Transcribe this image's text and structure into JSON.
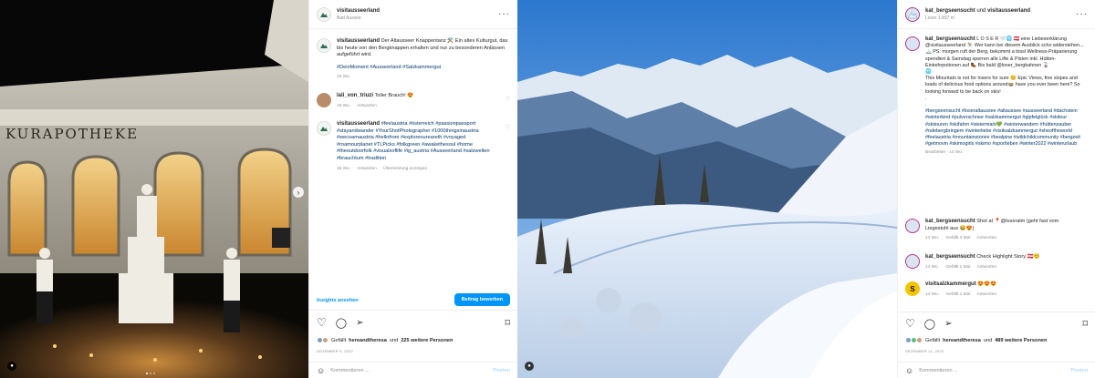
{
  "post1": {
    "header": {
      "username": "visitausseerland",
      "location": "Bad Aussee"
    },
    "caption": {
      "username": "visitausseerland",
      "text": "Der Altausseer Knappentanz ⚒️ Ein altes Kulturgut, das bis heute von den Bergknappen erhalten und nur zu besonderen Anlässen aufgeführt wird.",
      "hashtags": "#DeinMoment #Ausseerland #Salzkammergut",
      "age": "15 Wo."
    },
    "comments": [
      {
        "username": "lali_von_triuzi",
        "text": "Toller Brauch! 😍",
        "age": "15 Wo.",
        "reply": "Antworten"
      },
      {
        "username": "visitausseerland",
        "text": "#feelaustria #österreich #passionpassport #stayandwander #YourShotPhotographer #1000thingsinaustria #wecoamaustria #hellofrom #exploreoureareth #voyaged #roamourplanet #TLPicks #folkgreen #awakethesoul #home #theoutdoorfolk #visualsoflife #ig_austria #Ausseerland #salzwelten #brauchtum #tradition",
        "age": "15 Wo.",
        "reply": "Antworten",
        "translate": "Übersetzung anzeigen"
      }
    ],
    "insights_label": "Insights ansehen",
    "boost_label": "Beitrag bewerben",
    "likes": {
      "prefix": "Gefällt",
      "by": "hereandtheresa",
      "middle": "und",
      "others": "225 weitere Personen"
    },
    "date": "DEZEMBER 9, 2022",
    "add_comment_placeholder": "Kommentieren ...",
    "post_label": "Posten",
    "photo_sign": "KURAPOTHEKE"
  },
  "post2": {
    "header": {
      "username": "kat_bergseensucht",
      "connector": "und",
      "coauthor": "visitausseerland",
      "location": "Loser 1.837 m"
    },
    "caption": {
      "username": "kat_bergseensucht",
      "text": "L O S E R 🤍🌐 🇦🇹 eine Liebeserklärung @visitausseerland ⛷️ Wer kann bei diesem Ausblick scho widerstehen... 🏔️ PS: morgen ruft der Berg, bekommt a bissl Wellness-Präparierung spendiert & Samstag sperren alle Lifte & Pisten inkl. Hütten- Einkehrpotionen auf 🥾 Bis bald @loser_bergbahnen 🚡",
      "emoji_line": "🌐",
      "english": "This Mountain is not for losers for sure 😊 Epic Views, fine slopes and loads of delicious food options around🍲 have you ever been here? So looking forward to be back on skis!",
      "dots": ".",
      "hashtags": "#bergseensucht #loseraltaussee #altaussee #ausseerland #dachstein #winterkind #pulverschnee #salzkammergut #gipfelglück #skitour #skitouren #skifahrn #steiermark💚 #winterwandern #hüttenzauber #ndebergbringem #winterliebe #visitsalzkammergut #sheoftheworld #feelaustria #mountainstories #bealpine #wildchildcommunity #bergzeit #getmovin #skimogirls #skimo #sportleben #winter2022 #winterurlaub",
      "edited": "Bearbeitet · 14 Wo."
    },
    "comments": [
      {
        "username": "kat_bergseensucht",
        "text": "Shot at 📍@loseralm (geht fast vom Liegestuhl aus 😂😍)",
        "age": "14 Wo.",
        "likes": "Gefällt 3 Mal",
        "reply": "Antworten"
      },
      {
        "username": "kat_bergseensucht",
        "text": "Check Highlight Story 🇦🇹☺️",
        "age": "14 Wo.",
        "likes": "Gefällt 1 Mal",
        "reply": "Antworten"
      },
      {
        "username": "visitsalzkammergut",
        "text": "😍😍😍",
        "age": "14 Wo.",
        "likes": "Gefällt 1 Mal",
        "reply": "Antworten"
      }
    ],
    "likes": {
      "prefix": "Gefällt",
      "by": "hereandtheresa",
      "middle": "und",
      "others": "489 weitere Personen"
    },
    "date": "DEZEMBER 14, 2022",
    "add_comment_placeholder": "Kommentieren ...",
    "post_label": "Posten"
  },
  "colors": {
    "link": "#00376b",
    "accent": "#0095f6",
    "muted": "#8e8e8e"
  }
}
